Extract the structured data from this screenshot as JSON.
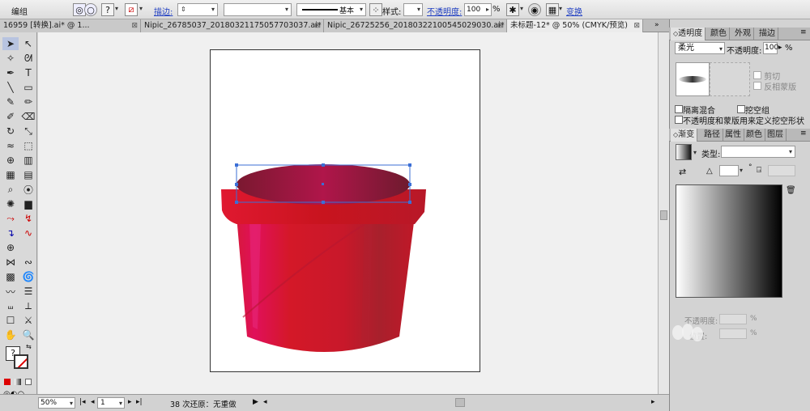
{
  "control_bar": {
    "group_label": "编组",
    "stroke_label": "描边:",
    "weight_label": "基本",
    "style_label": "样式:",
    "opacity_label": "不透明度:",
    "opacity_value": "100",
    "percent": "%",
    "transform_label": "变换"
  },
  "tabs": [
    {
      "label": "16959  [转换].ai* @ 1..."
    },
    {
      "label": "Nipic_26785037_20180321175057703037.ai*"
    },
    {
      "label": "Nipic_26725256_20180322100545029030.ai*"
    },
    {
      "label": "未标题-12* @ 50% (CMYK/预览)"
    }
  ],
  "status": {
    "zoom": "50%",
    "page": "1",
    "undo_text": "38 次还原：无重做"
  },
  "transparency_panel": {
    "tabs": [
      "透明度",
      "颜色",
      "外观",
      "描边"
    ],
    "blend_mode": "柔光",
    "opacity_label": "不透明度:",
    "opacity_value": "100",
    "percent": "%",
    "clip_label": "剪切",
    "invert_mask_label": "反相蒙版",
    "isolate_label": "隔离混合",
    "knockout_label": "挖空组",
    "opacity_mask_label": "不透明度和蒙版用来定义挖空形状"
  },
  "gradient_panel": {
    "tabs": [
      "渐变",
      "路径",
      "属性",
      "颜色",
      "图层"
    ],
    "type_label": "类型:",
    "angle_symbol": "°",
    "opacity_label": "不透明度:",
    "location_label": "位置:",
    "percent": "%"
  },
  "colors": {
    "bucket_red": "#d41828",
    "bucket_pink": "#e0105a",
    "rim_dark": "#7a1830",
    "selection_blue": "#3b6fd6"
  }
}
